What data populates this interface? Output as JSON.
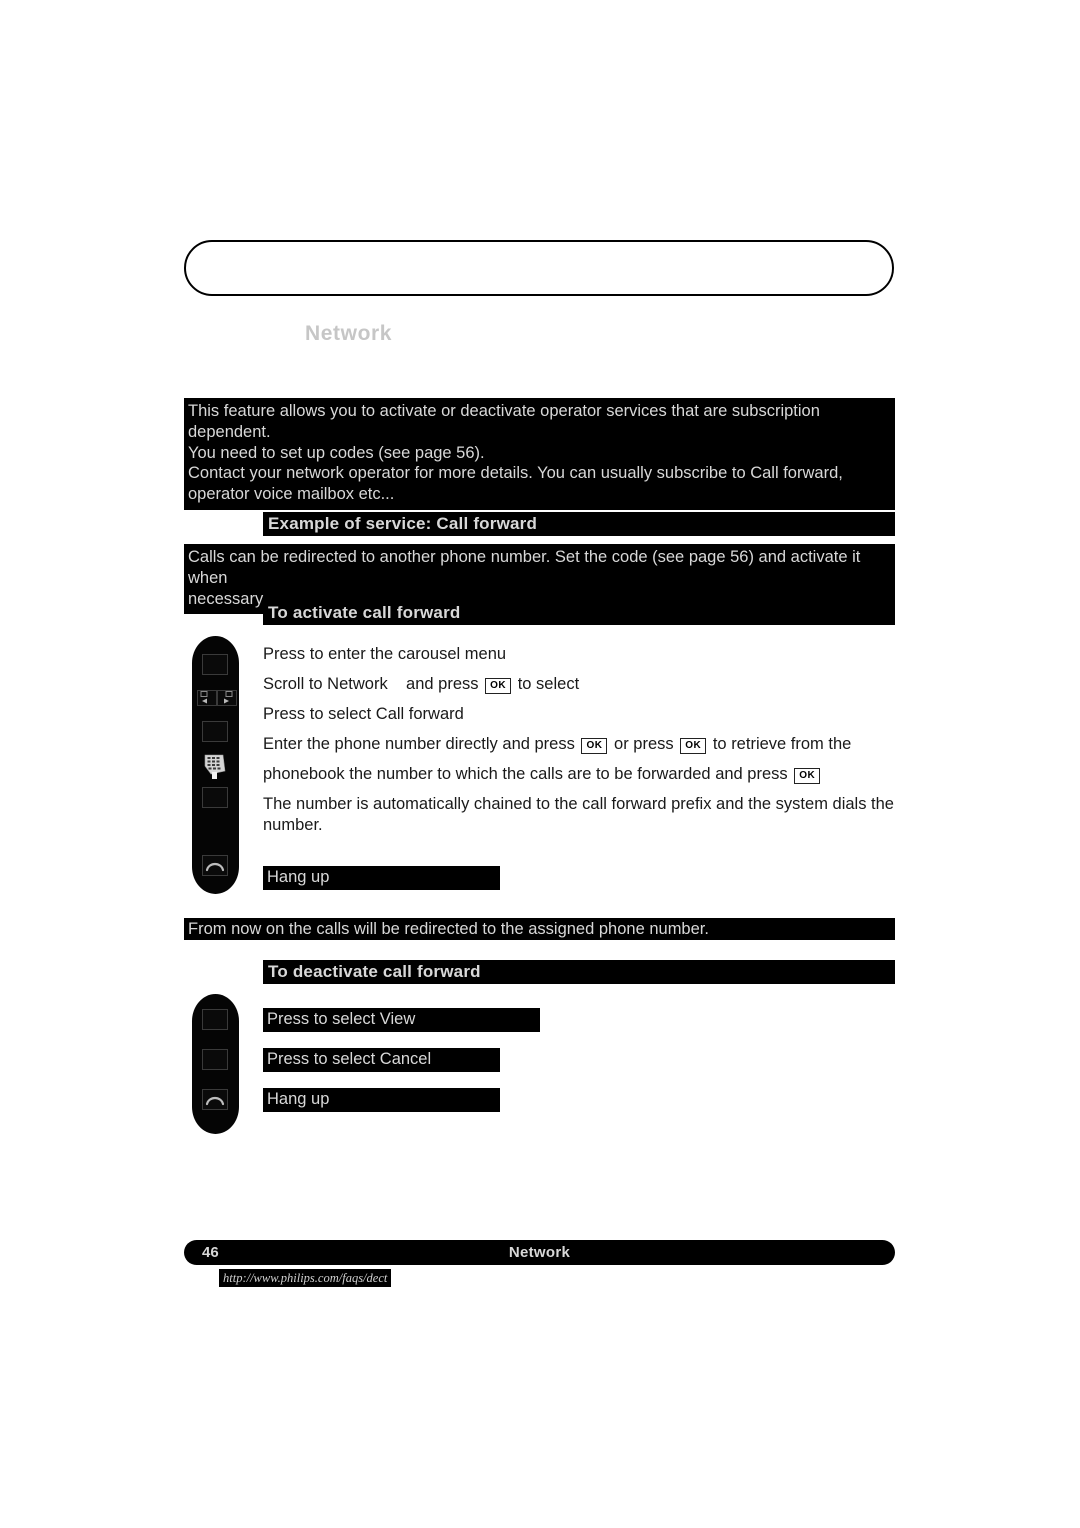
{
  "document": {
    "running_head": "Network",
    "page_number": "46",
    "footer_title": "Network",
    "footer_url": "http://www.philips.com/faqs/dect"
  },
  "intro": {
    "lines": [
      "This feature allows you to activate or deactivate operator services that are subscription dependent.",
      "You need to set up codes (see page 56).",
      "Contact your network operator for more details. You can usually subscribe to Call forward,",
      "operator voice mailbox etc..."
    ]
  },
  "section": {
    "title": "Example of service: Call forward",
    "description": [
      "Calls can be redirected to another phone number. Set the code (see page 56) and activate it when",
      "necessary."
    ]
  },
  "activate": {
    "heading": "To activate call forward",
    "steps": [
      {
        "text": "Press to enter the carousel menu"
      },
      {
        "pre": "Scroll to Network",
        "key": "OK",
        "mid": "and press",
        "post": "to select"
      },
      {
        "text": "Press to select Call forward"
      },
      {
        "pre": "Enter the phone number directly and press",
        "key": "OK",
        "mid": "or press",
        "key2": "OK",
        "post": "to retrieve from the"
      },
      {
        "pre": "phonebook the number to which the calls are to be forwarded and press",
        "key": "OK",
        "post": ""
      },
      {
        "text": "The number is automatically chained to the call forward prefix and the system dials the"
      },
      {
        "text": "number."
      }
    ],
    "hangup_label": "Hang up",
    "buttons": [
      {
        "name": "soft-key-top",
        "type": "square"
      },
      {
        "name": "nav-left",
        "type": "nav-left"
      },
      {
        "name": "nav-right",
        "type": "nav-right"
      },
      {
        "name": "soft-key-mid",
        "type": "square"
      },
      {
        "name": "keypad",
        "type": "keypad"
      },
      {
        "name": "soft-key-low",
        "type": "square"
      },
      {
        "name": "hang-up",
        "type": "hangup"
      }
    ]
  },
  "note": "From now on the calls will be redirected to the assigned phone number.",
  "deactivate": {
    "heading": "To deactivate call forward",
    "steps": [
      {
        "label": "Press to select View"
      },
      {
        "label": "Press to select Cancel"
      },
      {
        "label": "Hang up"
      }
    ],
    "buttons": [
      {
        "name": "soft-key-view",
        "type": "square"
      },
      {
        "name": "soft-key-cancel",
        "type": "square"
      },
      {
        "name": "hang-up",
        "type": "hangup"
      }
    ]
  },
  "colors": {
    "ink": "#000000",
    "reverse_text": "#d8d8d8",
    "running_head": "#c6c6c6"
  }
}
